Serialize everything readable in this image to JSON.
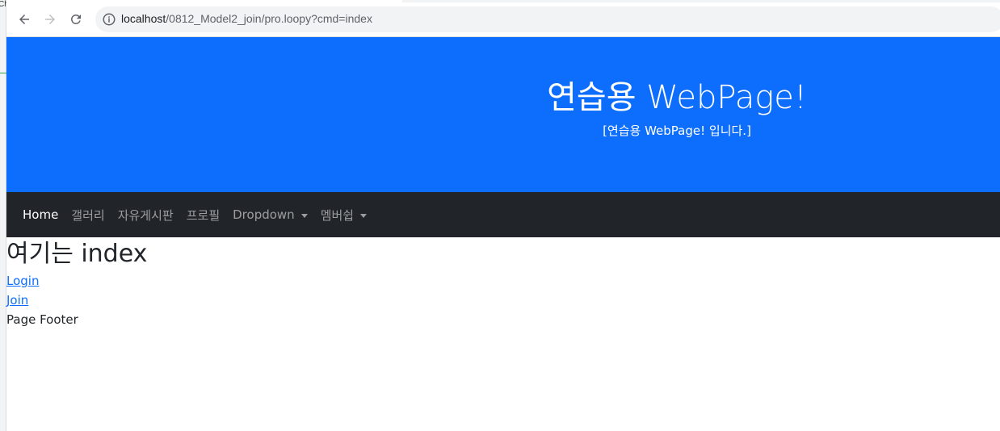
{
  "browser": {
    "left_fragment": "Ch",
    "url_host": "localhost",
    "url_path": "/0812_Model2_join/pro.loopy?cmd=index"
  },
  "hero": {
    "title": "연습용 WebPage!",
    "subtitle": "[연습용 WebPage! 입니다.]"
  },
  "navbar": {
    "items": [
      {
        "label": "Home",
        "active": true
      },
      {
        "label": "갤러리"
      },
      {
        "label": "자유게시판"
      },
      {
        "label": "프로필"
      },
      {
        "label": "Dropdown",
        "dropdown": true
      },
      {
        "label": "멤버쉽",
        "dropdown": true
      }
    ]
  },
  "content": {
    "heading": "여기는 index",
    "links": [
      "Login",
      "Join"
    ],
    "footer": "Page Footer"
  },
  "colors": {
    "primary": "#0d6efd",
    "navbar_bg": "#212529",
    "link": "#0d6efd"
  }
}
